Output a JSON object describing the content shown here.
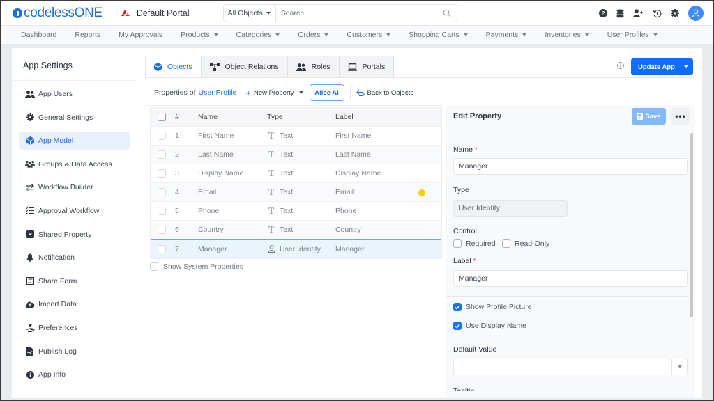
{
  "app": {
    "logo_text": "codelessONE",
    "portal_name": "Default Portal",
    "brand_color": "#1a6fd9",
    "accent_color": "#0d6efd"
  },
  "search": {
    "scope": "All Objects",
    "placeholder": "Search",
    "value": ""
  },
  "top_icons": [
    "help-icon",
    "database-icon",
    "add-user-icon",
    "history-icon",
    "gear-icon",
    "user-avatar"
  ],
  "nav": [
    {
      "label": "Dashboard",
      "dropdown": false
    },
    {
      "label": "Reports",
      "dropdown": false
    },
    {
      "label": "My Approvals",
      "dropdown": false
    },
    {
      "label": "Products",
      "dropdown": true
    },
    {
      "label": "Categories",
      "dropdown": true
    },
    {
      "label": "Orders",
      "dropdown": true
    },
    {
      "label": "Customers",
      "dropdown": true
    },
    {
      "label": "Shopping Carts",
      "dropdown": true
    },
    {
      "label": "Payments",
      "dropdown": true
    },
    {
      "label": "Inventories",
      "dropdown": true
    },
    {
      "label": "User Profiles",
      "dropdown": true
    }
  ],
  "sidebar": {
    "title": "App Settings",
    "items": [
      {
        "label": "App Users",
        "icon": "users-icon",
        "active": false
      },
      {
        "label": "General Settings",
        "icon": "gear-icon",
        "active": false
      },
      {
        "label": "App Model",
        "icon": "cube-icon",
        "active": true
      },
      {
        "label": "Groups & Data Access",
        "icon": "groups-icon",
        "active": false
      },
      {
        "label": "Workflow Builder",
        "icon": "arrows-exchange-icon",
        "active": false
      },
      {
        "label": "Approval Workflow",
        "icon": "checklist-icon",
        "active": false
      },
      {
        "label": "Shared Property",
        "icon": "inbox-icon",
        "active": false
      },
      {
        "label": "Notification",
        "icon": "bell-icon",
        "active": false
      },
      {
        "label": "Share Form",
        "icon": "form-icon",
        "active": false
      },
      {
        "label": "Import Data",
        "icon": "cloud-upload-icon",
        "active": false
      },
      {
        "label": "Preferences",
        "icon": "hand-heart-icon",
        "active": false
      },
      {
        "label": "Publish Log",
        "icon": "file-log-icon",
        "active": false
      },
      {
        "label": "App Info",
        "icon": "info-circle-icon",
        "active": false
      }
    ]
  },
  "tabs": [
    {
      "label": "Objects",
      "icon": "cube-icon",
      "active": true
    },
    {
      "label": "Object Relations",
      "icon": "relations-icon",
      "active": false
    },
    {
      "label": "Roles",
      "icon": "users-icon",
      "active": false
    },
    {
      "label": "Portals",
      "icon": "laptop-icon",
      "active": false
    }
  ],
  "header_actions": {
    "update_label": "Update App"
  },
  "toolbar": {
    "properties_of": "Properties of",
    "object_name": "User Profile",
    "new_property": "New Property",
    "alice_ai": "Alice AI",
    "back": "Back to Objects"
  },
  "table": {
    "columns": [
      "#",
      "Name",
      "Type",
      "Label"
    ],
    "rows": [
      {
        "num": "1",
        "name": "First Name",
        "type": "Text",
        "type_icon": "text-type-icon",
        "label": "First Name",
        "selected": false,
        "marker": false
      },
      {
        "num": "2",
        "name": "Last Name",
        "type": "Text",
        "type_icon": "text-type-icon",
        "label": "Last Name",
        "selected": false,
        "marker": false
      },
      {
        "num": "3",
        "name": "Display Name",
        "type": "Text",
        "type_icon": "text-type-icon",
        "label": "Display Name",
        "selected": false,
        "marker": false
      },
      {
        "num": "4",
        "name": "Email",
        "type": "Text",
        "type_icon": "text-type-icon",
        "label": "Email",
        "selected": false,
        "marker": true
      },
      {
        "num": "5",
        "name": "Phone",
        "type": "Text",
        "type_icon": "text-type-icon",
        "label": "Phone",
        "selected": false,
        "marker": false
      },
      {
        "num": "6",
        "name": "Country",
        "type": "Text",
        "type_icon": "text-type-icon",
        "label": "Country",
        "selected": false,
        "marker": false
      },
      {
        "num": "7",
        "name": "Manager",
        "type": "User Identity",
        "type_icon": "user-identity-icon",
        "label": "Manager",
        "selected": true,
        "marker": false
      }
    ],
    "show_system_properties": "Show System Properties"
  },
  "edit": {
    "title": "Edit Property",
    "save_label": "Save",
    "more_label": "•••",
    "name_label": "Name",
    "name_value": "Manager",
    "type_label": "Type",
    "type_value": "User Identity",
    "control_label": "Control",
    "required_label": "Required",
    "required_checked": false,
    "readonly_label": "Read-Only",
    "readonly_checked": false,
    "label_label": "Label",
    "label_value": "Manager",
    "show_profile_picture": "Show Profile Picture",
    "show_profile_picture_checked": true,
    "use_display_name": "Use Display Name",
    "use_display_name_checked": true,
    "default_value_label": "Default Value",
    "default_value": "",
    "cut_off_label": "Tooltip"
  }
}
